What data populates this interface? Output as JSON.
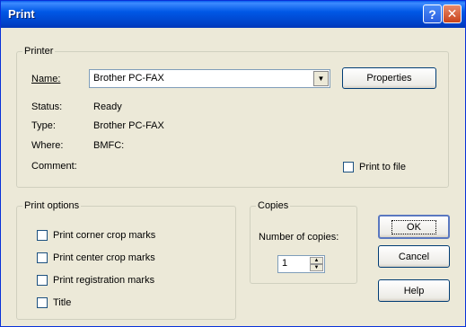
{
  "window": {
    "title": "Print",
    "help_glyph": "?",
    "close_glyph": "✕"
  },
  "printer": {
    "group_label": "Printer",
    "name_label": "Name:",
    "name_value": "Brother PC-FAX",
    "properties_button": "Properties",
    "status_label": "Status:",
    "status_value": "Ready",
    "type_label": "Type:",
    "type_value": "Brother PC-FAX",
    "where_label": "Where:",
    "where_value": "BMFC:",
    "comment_label": "Comment:",
    "print_to_file_label": "Print to file"
  },
  "print_options": {
    "group_label": "Print options",
    "items": [
      {
        "label": "Print corner crop marks",
        "checked": false
      },
      {
        "label": "Print center crop marks",
        "checked": false
      },
      {
        "label": "Print registration marks",
        "checked": false
      },
      {
        "label": "Title",
        "checked": false
      }
    ]
  },
  "copies": {
    "group_label": "Copies",
    "number_label": "Number of copies:",
    "value": "1"
  },
  "buttons": {
    "ok": "OK",
    "cancel": "Cancel",
    "help": "Help"
  },
  "icons": {
    "dropdown": "chevron-down-icon",
    "spin_up": "spin-up-icon",
    "spin_down": "spin-down-icon"
  }
}
